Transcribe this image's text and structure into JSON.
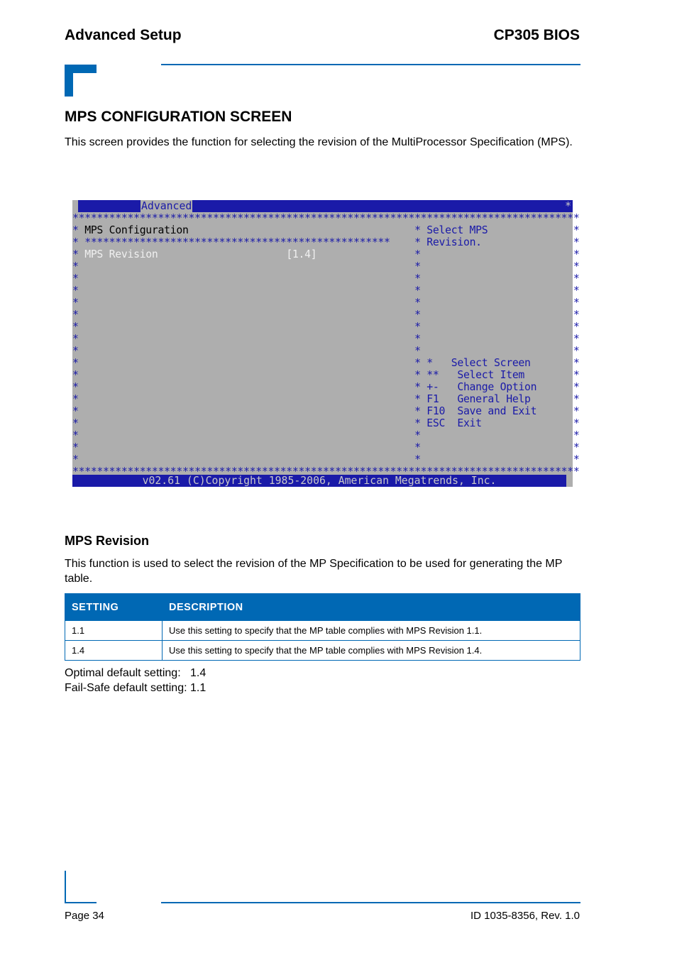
{
  "header": {
    "left": "Advanced Setup",
    "right": "CP305 BIOS"
  },
  "section": {
    "title": "MPS CONFIGURATION SCREEN",
    "intro": "This screen provides the function for selecting the revision of the MultiProcessor Specification (MPS)."
  },
  "bios_screen": {
    "tab": "Advanced",
    "title_star": "*",
    "border_row": "*****************************************************************************************",
    "screen_title": "MPS Configuration",
    "inner_border": "**************************************************",
    "item": {
      "label": "MPS Revision",
      "value": "[1.4]"
    },
    "help_lines": [
      "Select MPS",
      "Revision."
    ],
    "keys": [
      {
        "key": "*",
        "action": "Select Screen"
      },
      {
        "key": "**",
        "action": "Select Item"
      },
      {
        "key": "+-",
        "action": "Change Option"
      },
      {
        "key": "F1",
        "action": "General Help"
      },
      {
        "key": "F10",
        "action": "Save and Exit"
      },
      {
        "key": "ESC",
        "action": "Exit"
      }
    ],
    "footer": "v02.61 (C)Copyright 1985-2006, American Megatrends, Inc."
  },
  "subsection": {
    "title": "MPS Revision",
    "intro": "This function is used to select the revision of the MP Specification to be used for generating the MP table."
  },
  "table": {
    "headers": [
      "SETTING",
      "DESCRIPTION"
    ],
    "rows": [
      [
        "1.1",
        "Use this setting to specify that the MP table complies with MPS Revision 1.1."
      ],
      [
        "1.4",
        "Use this setting to specify that the MP table complies with MPS Revision 1.4."
      ]
    ]
  },
  "defaults": {
    "optimal_label": "Optimal default setting:   ",
    "optimal_value": "1.4",
    "failsafe_label": "Fail-Safe default setting: ",
    "failsafe_value": "1.1"
  },
  "footer": {
    "left": "Page 34",
    "right": "ID 1035-8356, Rev. 1.0"
  },
  "colors": {
    "accent": "#0068b4",
    "bios_blue": "#1a1aa8",
    "bios_gray": "#aeaeae"
  }
}
